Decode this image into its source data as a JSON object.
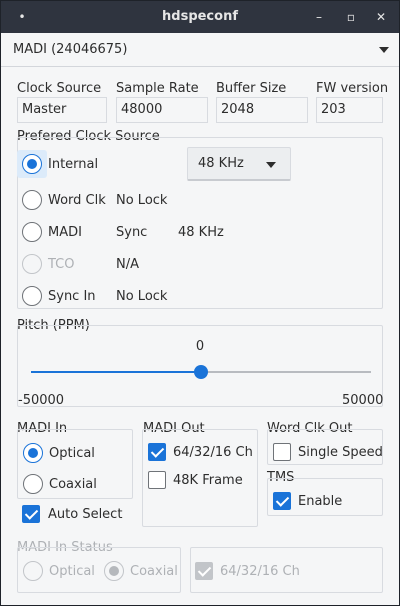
{
  "window": {
    "title": "hdspeconf",
    "menu_glyph": "•",
    "minimize_glyph": "–",
    "maximize_glyph": "▫",
    "close_glyph": "✕"
  },
  "device": {
    "selected": "MADI (24046675)"
  },
  "info": {
    "clock_source": {
      "label": "Clock Source",
      "value": "Master"
    },
    "sample_rate": {
      "label": "Sample Rate",
      "value": "48000"
    },
    "buffer_size": {
      "label": "Buffer Size",
      "value": "2048"
    },
    "fw_version": {
      "label": "FW version",
      "value": "203"
    }
  },
  "pref_clock": {
    "title": "Prefered Clock Source",
    "rate_select": "48 KHz",
    "options": [
      {
        "label": "Internal",
        "status": "",
        "rate": "",
        "selected": true,
        "enabled": true
      },
      {
        "label": "Word Clk",
        "status": "No Lock",
        "rate": "",
        "selected": false,
        "enabled": true
      },
      {
        "label": "MADI",
        "status": "Sync",
        "rate": "48 KHz",
        "selected": false,
        "enabled": true
      },
      {
        "label": "TCO",
        "status": "N/A",
        "rate": "",
        "selected": false,
        "enabled": false
      },
      {
        "label": "Sync In",
        "status": "No Lock",
        "rate": "",
        "selected": false,
        "enabled": true
      }
    ]
  },
  "pitch": {
    "title": "Pitch (PPM)",
    "value": "0",
    "min": "-50000",
    "max": "50000",
    "fraction": 0.5
  },
  "madi_in": {
    "title": "MADI In",
    "optical": {
      "label": "Optical",
      "selected": true
    },
    "coaxial": {
      "label": "Coaxial",
      "selected": false
    },
    "auto_select": {
      "label": "Auto Select",
      "checked": true
    }
  },
  "madi_out": {
    "title": "MADI Out",
    "ch64": {
      "label": "64/32/16 Ch",
      "checked": true
    },
    "frame48k": {
      "label": "48K Frame",
      "checked": false
    }
  },
  "word_clk_out": {
    "title": "Word Clk Out",
    "single_speed": {
      "label": "Single Speed",
      "checked": false
    }
  },
  "tms": {
    "title": "TMS",
    "enable": {
      "label": "Enable",
      "checked": true
    }
  },
  "madi_in_status": {
    "title": "MADI In Status",
    "optical": {
      "label": "Optical",
      "selected": false
    },
    "coaxial": {
      "label": "Coaxial",
      "selected": true
    },
    "ch64": {
      "label": "64/32/16 Ch",
      "checked": true
    }
  },
  "colors": {
    "accent": "#1a73d8",
    "titlebar": "#2f343f",
    "background": "#f5f6f7"
  }
}
